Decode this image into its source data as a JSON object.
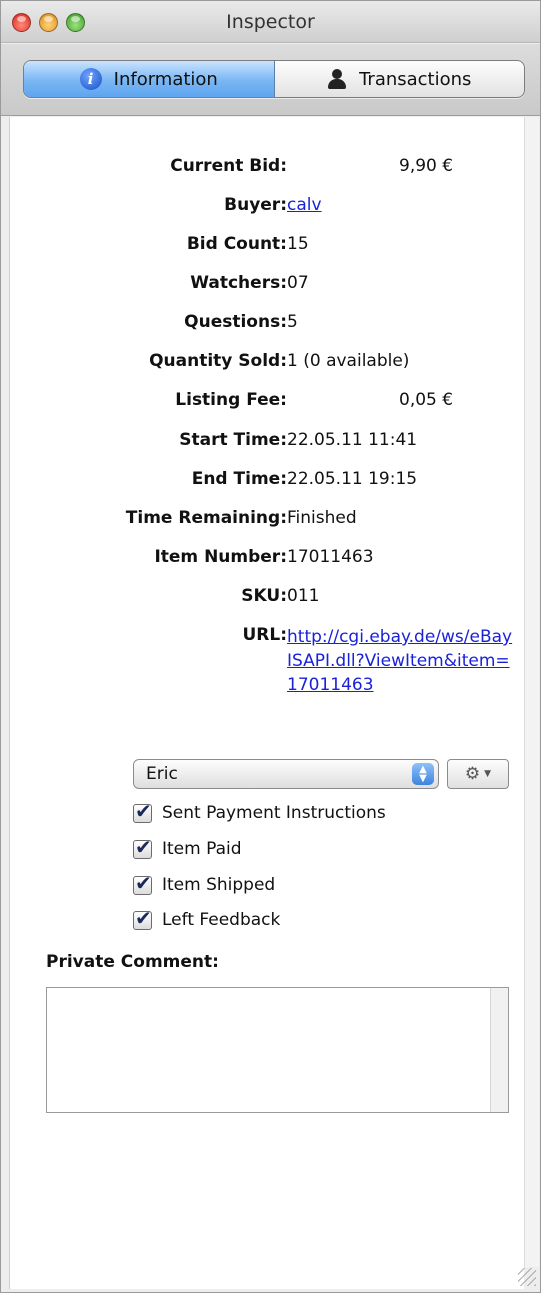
{
  "window": {
    "title": "Inspector"
  },
  "tabs": [
    {
      "label": "Information",
      "icon": "info-icon",
      "active": true
    },
    {
      "label": "Transactions",
      "icon": "person-icon",
      "active": false
    }
  ],
  "fields": {
    "current_bid": {
      "label": "Current Bid:",
      "value": "9,90 €"
    },
    "buyer": {
      "label": "Buyer:",
      "value": "calv"
    },
    "bid_count": {
      "label": "Bid Count:",
      "value": "15"
    },
    "watchers": {
      "label": "Watchers:",
      "value": "07"
    },
    "questions": {
      "label": "Questions:",
      "value": "5"
    },
    "quantity_sold": {
      "label": "Quantity Sold:",
      "value": "1 (0 available)"
    },
    "listing_fee": {
      "label": "Listing Fee:",
      "value": "0,05 €"
    },
    "start_time": {
      "label": "Start Time:",
      "value": "22.05.11 11:41"
    },
    "end_time": {
      "label": "End Time:",
      "value": "22.05.11 19:15"
    },
    "time_remaining": {
      "label": "Time Remaining:",
      "value": "Finished"
    },
    "item_number": {
      "label": "Item Number:",
      "value": "17011463"
    },
    "sku": {
      "label": "SKU:",
      "value": "011"
    },
    "url": {
      "label": "URL:",
      "value": "http://cgi.ebay.de/ws/eBayISAPI.dll?ViewItem&item=17011463"
    }
  },
  "user_popup": {
    "selected": "Eric"
  },
  "checkboxes": [
    {
      "label": "Sent Payment Instructions",
      "checked": true
    },
    {
      "label": "Item Paid",
      "checked": true
    },
    {
      "label": "Item Shipped",
      "checked": true
    },
    {
      "label": "Left Feedback",
      "checked": true
    }
  ],
  "private_comment": {
    "label": "Private Comment:",
    "value": ""
  }
}
